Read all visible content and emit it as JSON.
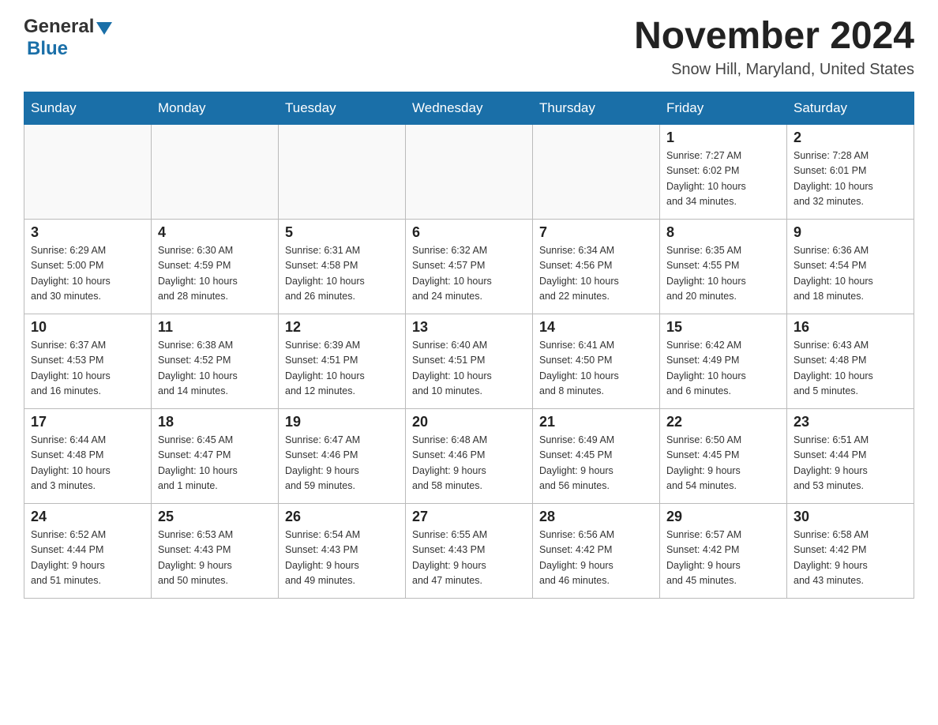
{
  "header": {
    "logo_general": "General",
    "logo_blue": "Blue",
    "month_title": "November 2024",
    "location": "Snow Hill, Maryland, United States"
  },
  "days_of_week": [
    "Sunday",
    "Monday",
    "Tuesday",
    "Wednesday",
    "Thursday",
    "Friday",
    "Saturday"
  ],
  "weeks": [
    [
      {
        "day": "",
        "info": ""
      },
      {
        "day": "",
        "info": ""
      },
      {
        "day": "",
        "info": ""
      },
      {
        "day": "",
        "info": ""
      },
      {
        "day": "",
        "info": ""
      },
      {
        "day": "1",
        "info": "Sunrise: 7:27 AM\nSunset: 6:02 PM\nDaylight: 10 hours\nand 34 minutes."
      },
      {
        "day": "2",
        "info": "Sunrise: 7:28 AM\nSunset: 6:01 PM\nDaylight: 10 hours\nand 32 minutes."
      }
    ],
    [
      {
        "day": "3",
        "info": "Sunrise: 6:29 AM\nSunset: 5:00 PM\nDaylight: 10 hours\nand 30 minutes."
      },
      {
        "day": "4",
        "info": "Sunrise: 6:30 AM\nSunset: 4:59 PM\nDaylight: 10 hours\nand 28 minutes."
      },
      {
        "day": "5",
        "info": "Sunrise: 6:31 AM\nSunset: 4:58 PM\nDaylight: 10 hours\nand 26 minutes."
      },
      {
        "day": "6",
        "info": "Sunrise: 6:32 AM\nSunset: 4:57 PM\nDaylight: 10 hours\nand 24 minutes."
      },
      {
        "day": "7",
        "info": "Sunrise: 6:34 AM\nSunset: 4:56 PM\nDaylight: 10 hours\nand 22 minutes."
      },
      {
        "day": "8",
        "info": "Sunrise: 6:35 AM\nSunset: 4:55 PM\nDaylight: 10 hours\nand 20 minutes."
      },
      {
        "day": "9",
        "info": "Sunrise: 6:36 AM\nSunset: 4:54 PM\nDaylight: 10 hours\nand 18 minutes."
      }
    ],
    [
      {
        "day": "10",
        "info": "Sunrise: 6:37 AM\nSunset: 4:53 PM\nDaylight: 10 hours\nand 16 minutes."
      },
      {
        "day": "11",
        "info": "Sunrise: 6:38 AM\nSunset: 4:52 PM\nDaylight: 10 hours\nand 14 minutes."
      },
      {
        "day": "12",
        "info": "Sunrise: 6:39 AM\nSunset: 4:51 PM\nDaylight: 10 hours\nand 12 minutes."
      },
      {
        "day": "13",
        "info": "Sunrise: 6:40 AM\nSunset: 4:51 PM\nDaylight: 10 hours\nand 10 minutes."
      },
      {
        "day": "14",
        "info": "Sunrise: 6:41 AM\nSunset: 4:50 PM\nDaylight: 10 hours\nand 8 minutes."
      },
      {
        "day": "15",
        "info": "Sunrise: 6:42 AM\nSunset: 4:49 PM\nDaylight: 10 hours\nand 6 minutes."
      },
      {
        "day": "16",
        "info": "Sunrise: 6:43 AM\nSunset: 4:48 PM\nDaylight: 10 hours\nand 5 minutes."
      }
    ],
    [
      {
        "day": "17",
        "info": "Sunrise: 6:44 AM\nSunset: 4:48 PM\nDaylight: 10 hours\nand 3 minutes."
      },
      {
        "day": "18",
        "info": "Sunrise: 6:45 AM\nSunset: 4:47 PM\nDaylight: 10 hours\nand 1 minute."
      },
      {
        "day": "19",
        "info": "Sunrise: 6:47 AM\nSunset: 4:46 PM\nDaylight: 9 hours\nand 59 minutes."
      },
      {
        "day": "20",
        "info": "Sunrise: 6:48 AM\nSunset: 4:46 PM\nDaylight: 9 hours\nand 58 minutes."
      },
      {
        "day": "21",
        "info": "Sunrise: 6:49 AM\nSunset: 4:45 PM\nDaylight: 9 hours\nand 56 minutes."
      },
      {
        "day": "22",
        "info": "Sunrise: 6:50 AM\nSunset: 4:45 PM\nDaylight: 9 hours\nand 54 minutes."
      },
      {
        "day": "23",
        "info": "Sunrise: 6:51 AM\nSunset: 4:44 PM\nDaylight: 9 hours\nand 53 minutes."
      }
    ],
    [
      {
        "day": "24",
        "info": "Sunrise: 6:52 AM\nSunset: 4:44 PM\nDaylight: 9 hours\nand 51 minutes."
      },
      {
        "day": "25",
        "info": "Sunrise: 6:53 AM\nSunset: 4:43 PM\nDaylight: 9 hours\nand 50 minutes."
      },
      {
        "day": "26",
        "info": "Sunrise: 6:54 AM\nSunset: 4:43 PM\nDaylight: 9 hours\nand 49 minutes."
      },
      {
        "day": "27",
        "info": "Sunrise: 6:55 AM\nSunset: 4:43 PM\nDaylight: 9 hours\nand 47 minutes."
      },
      {
        "day": "28",
        "info": "Sunrise: 6:56 AM\nSunset: 4:42 PM\nDaylight: 9 hours\nand 46 minutes."
      },
      {
        "day": "29",
        "info": "Sunrise: 6:57 AM\nSunset: 4:42 PM\nDaylight: 9 hours\nand 45 minutes."
      },
      {
        "day": "30",
        "info": "Sunrise: 6:58 AM\nSunset: 4:42 PM\nDaylight: 9 hours\nand 43 minutes."
      }
    ]
  ]
}
